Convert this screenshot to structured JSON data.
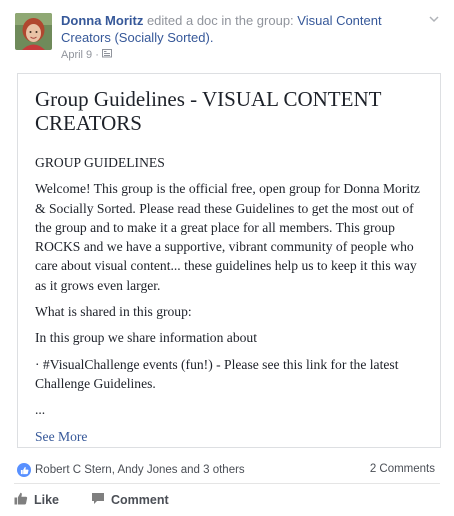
{
  "post": {
    "author": "Donna Moritz",
    "action_text": " edited a doc in the group: ",
    "group": "Visual Content Creators (Socially Sorted).",
    "date": "April 9",
    "separator": " · "
  },
  "doc": {
    "title": "Group Guidelines - VISUAL CONTENT CREATORS",
    "heading": "GROUP GUIDELINES",
    "paragraphs": [
      "Welcome! This group is the official free, open group for Donna Moritz & Socially Sorted. Please read these Guidelines to get the most out of the group and to make it a great place for all members. This group ROCKS and we have a supportive, vibrant community of people who care about visual content... these guidelines help us to keep it this way as it grows even larger.",
      "What is shared in this group:",
      "In this group we share information about",
      "· #VisualChallenge events (fun!) - Please see this link for the latest Challenge Guidelines.",
      "..."
    ],
    "see_more": "See More"
  },
  "footer": {
    "reactions": "Robert C Stern, Andy Jones and 3 others",
    "comments": "2 Comments",
    "like_label": "Like",
    "comment_label": "Comment"
  },
  "colors": {
    "link": "#365899",
    "like_blue": "#5890ff"
  }
}
